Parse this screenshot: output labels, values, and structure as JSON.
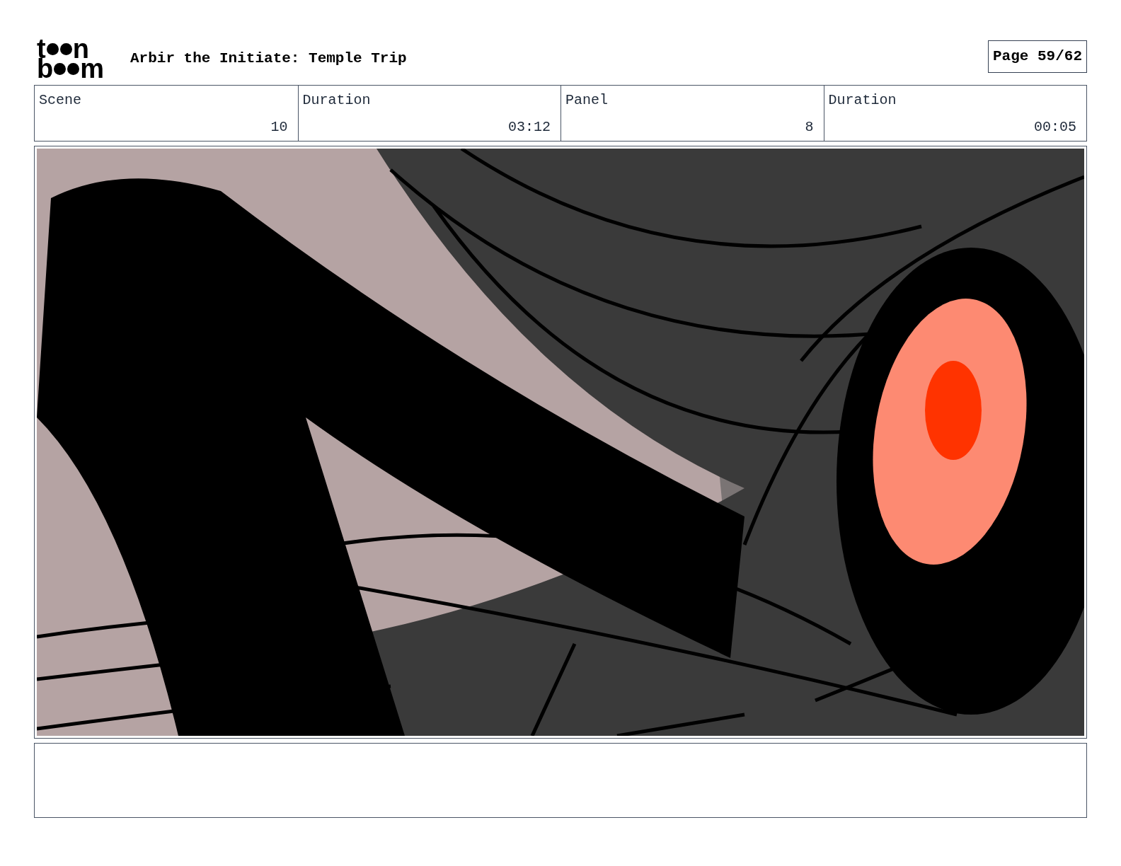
{
  "logo": {
    "line_1": [
      "t",
      "n"
    ],
    "line_2": [
      "b",
      "m"
    ]
  },
  "title": "Arbir the Initiate: Temple Trip",
  "page": "Page 59/62",
  "fields": [
    {
      "label": "Scene",
      "value": "10"
    },
    {
      "label": "Duration",
      "value": "03:12"
    },
    {
      "label": "Panel",
      "value": "8"
    },
    {
      "label": "Duration",
      "value": "00:05"
    }
  ]
}
